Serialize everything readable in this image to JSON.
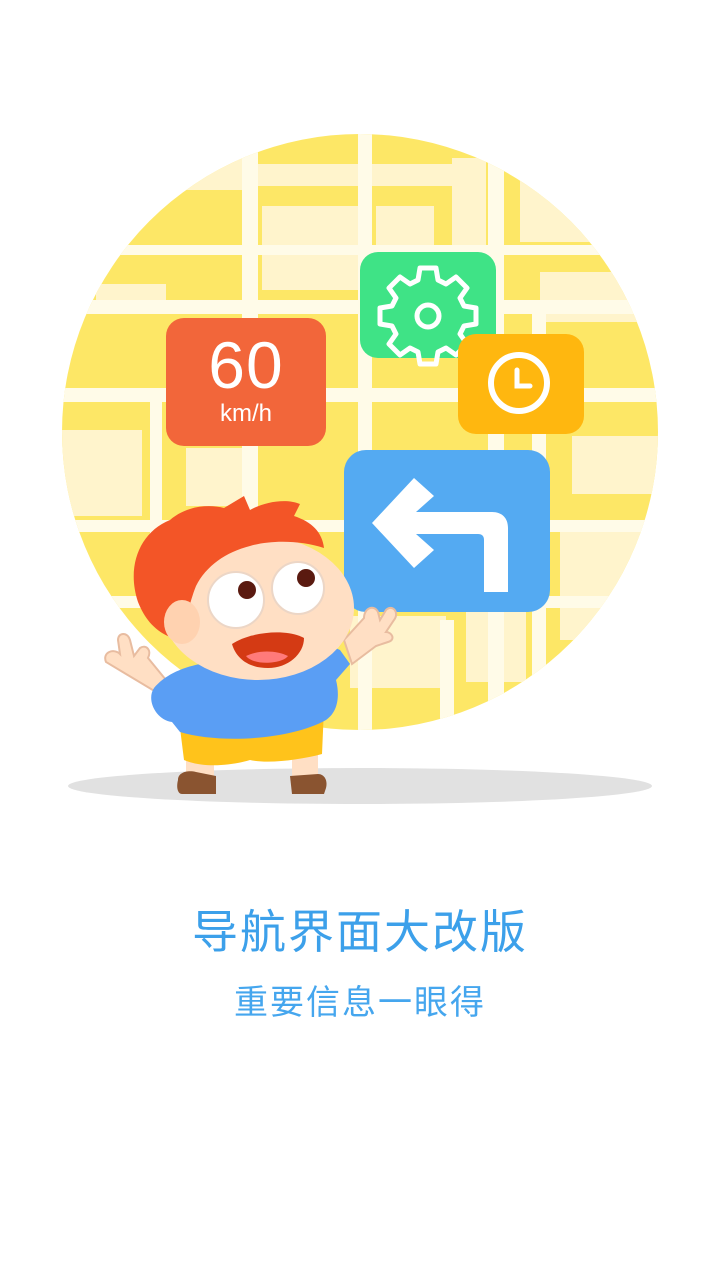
{
  "illustration": {
    "speed_card": {
      "value": "60",
      "unit": "km/h"
    },
    "icons": [
      "settings-gear-icon",
      "clock-icon",
      "turn-left-arrow-icon"
    ],
    "colors": {
      "map_yellow": "#fde766",
      "map_light": "#fff4cc",
      "speed_orange": "#f2663a",
      "settings_green": "#3fe386",
      "clock_amber": "#ffb70f",
      "arrow_blue": "#54aaf2",
      "hair_orange": "#f35527",
      "shirt_blue": "#5a9ef4",
      "shorts_yellow": "#ffc31b"
    }
  },
  "text": {
    "title": "导航界面大改版",
    "subtitle": "重要信息一眼得"
  },
  "colors": {
    "title": "#3ca0ea",
    "subtitle": "#45a6ee",
    "background": "#ffffff"
  }
}
